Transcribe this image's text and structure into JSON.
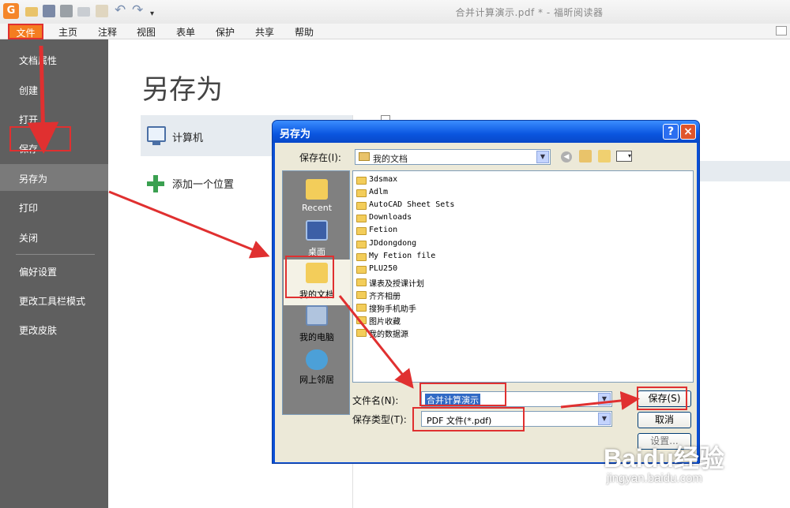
{
  "window": {
    "title": "合并计算演示.pdf * - 福昕阅读器"
  },
  "ribbon": {
    "tabs": [
      "文件",
      "主页",
      "注释",
      "视图",
      "表单",
      "保护",
      "共享",
      "帮助"
    ]
  },
  "sidebar": {
    "items": [
      "文档属性",
      "创建",
      "打开",
      "保存",
      "另存为",
      "打印",
      "关闭",
      "偏好设置",
      "更改工具栏模式",
      "更改皮肤"
    ],
    "selected": "另存为"
  },
  "main": {
    "title": "另存为",
    "locations": [
      {
        "label": "计算机",
        "icon": "computer-icon"
      },
      {
        "label": "添加一个位置",
        "icon": "plus-icon"
      }
    ]
  },
  "dialog": {
    "title": "另存为",
    "save_in_label": "保存在(I):",
    "save_in_value": "我的文档",
    "places": [
      "Recent",
      "桌面",
      "我的文档",
      "我的电脑",
      "网上邻居"
    ],
    "files": [
      "3dsmax",
      "Adlm",
      "AutoCAD Sheet Sets",
      "Downloads",
      "Fetion",
      "JDdongdong",
      "My Fetion file",
      "PLU250",
      "课表及授课计划",
      "齐齐相册",
      "搜狗手机助手",
      "图片收藏",
      "我的数据源"
    ],
    "filename_label": "文件名(N):",
    "filename_value": "合并计算演示",
    "filetype_label": "保存类型(T):",
    "filetype_value": "PDF 文件(*.pdf)",
    "buttons": {
      "save": "保存(S)",
      "cancel": "取消",
      "settings": "设置..."
    },
    "help_glyph": "?",
    "close_glyph": "×"
  },
  "watermark": {
    "logo": "Baidu经验",
    "url": "jingyan.baidu.com"
  },
  "colors": {
    "accent": "#f47d20",
    "sidebar": "#5f5f5f",
    "annotation": "#e03030",
    "dialog_title": "#0a56e0"
  }
}
